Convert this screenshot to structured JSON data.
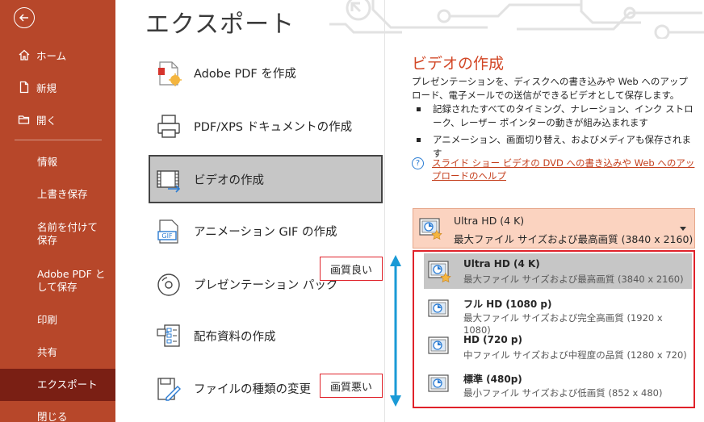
{
  "sidebar": {
    "top_items": [
      {
        "label": "ホーム",
        "icon": "home-icon"
      },
      {
        "label": "新規",
        "icon": "new-doc-icon"
      },
      {
        "label": "開く",
        "icon": "open-folder-icon"
      }
    ],
    "items": [
      {
        "label": "情報"
      },
      {
        "label": "上書き保存"
      },
      {
        "label": "名前を付けて保存"
      },
      {
        "label": "Adobe PDF として保存"
      },
      {
        "label": "印刷"
      },
      {
        "label": "共有"
      },
      {
        "label": "エクスポート",
        "active": true
      },
      {
        "label": "閉じる"
      }
    ]
  },
  "page": {
    "title": "エクスポート"
  },
  "options": [
    {
      "label": "Adobe PDF を作成",
      "icon": "adobe-pdf-icon"
    },
    {
      "label": "PDF/XPS ドキュメントの作成",
      "icon": "pdf-xps-icon"
    },
    {
      "label": "ビデオの作成",
      "icon": "video-icon",
      "selected": true
    },
    {
      "label": "アニメーション GIF の作成",
      "icon": "gif-icon"
    },
    {
      "label": "プレゼンテーション パック",
      "icon": "disc-icon"
    },
    {
      "label": "配布資料の作成",
      "icon": "handout-icon"
    },
    {
      "label": "ファイルの種類の変更",
      "icon": "file-type-icon"
    }
  ],
  "panel": {
    "title": "ビデオの作成",
    "desc": "プレゼンテーションを、ディスクへの書き込みや Web へのアップロード、電子メールでの送信ができるビデオとして保存します。",
    "bullets": [
      "記録されたすべてのタイミング、ナレーション、インク ストローク、レーザー ポインターの動きが組み込まれます",
      "アニメーション、画面切り替え、およびメディアも保存されます"
    ],
    "help_link": "スライド ショー ビデオの DVD への書き込みや Web へのアップロードのヘルプ"
  },
  "dropdown": {
    "title": "Ultra HD (4 K)",
    "sub": "最大ファイル サイズおよび最高画質 (3840 x 2160)"
  },
  "menu": [
    {
      "title": "Ultra HD (4 K)",
      "sub": "最大ファイル サイズおよび最高画質 (3840 x 2160)",
      "active": true
    },
    {
      "title": "フル HD (1080 p)",
      "sub": "最大ファイル サイズおよび完全高画質 (1920 x 1080)"
    },
    {
      "title": "HD (720 p)",
      "sub": "中ファイル サイズおよび中程度の品質 (1280 x 720)"
    },
    {
      "title": "標準 (480p)",
      "sub": "最小ファイル サイズおよび低画質 (852 x 480)"
    }
  ],
  "annotations": {
    "high": "画質良い",
    "low": "画質悪い"
  },
  "colors": {
    "sidebar": "#b7472a",
    "sidebar_active": "#7a1f14",
    "accent": "#d24726",
    "highlight_border": "#e0222a",
    "arrow": "#1a9ad6"
  }
}
